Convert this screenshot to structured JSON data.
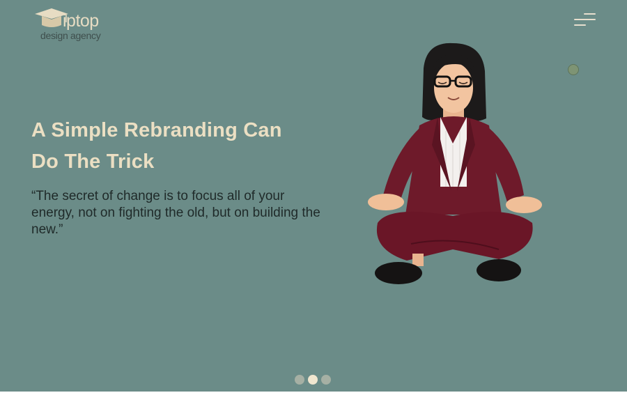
{
  "logo": {
    "brand": "iptop",
    "tagline": "design agency",
    "icon": "graduation-cap-icon"
  },
  "menu": {
    "icon": "hamburger-menu-icon"
  },
  "hero": {
    "headline_line1": "A Simple Rebranding Can",
    "headline_line2": "Do The Trick",
    "quote": "“The secret of change is to focus all of your energy, not on fighting the old, but on building the new.”",
    "illustration": "meditating-woman-illustration"
  },
  "carousel": {
    "slide_count": 3,
    "active_index": 1
  },
  "colors": {
    "hero_background": "#6b8c88",
    "headline": "#ebdfc3",
    "body_text": "#1f2a29",
    "accent_cream": "#f0e6cf"
  }
}
